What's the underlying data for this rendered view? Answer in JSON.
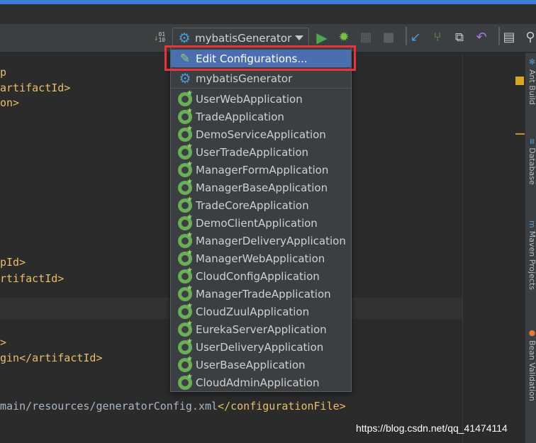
{
  "toolbar": {
    "run_config_label": "mybatisGenerator",
    "icons": [
      "sort-icon",
      "gear-icon",
      "run-icon",
      "debug-icon",
      "coverage-icon",
      "stop-icon",
      "vcs-update-icon",
      "vcs-commit-icon",
      "vcs-history-icon",
      "revert-icon",
      "project-structure-icon"
    ],
    "colors": {
      "run": "#4ea64e",
      "debug": "#7ac043",
      "accent": "#4b9bd6"
    }
  },
  "editor": {
    "lines": [
      {
        "text": "p"
      },
      {
        "text": "artifactId>"
      },
      {
        "text": "on>"
      },
      {
        "text": "pId>"
      },
      {
        "text": "rtifactId>"
      },
      {
        "text": ">"
      },
      {
        "text": "gin</artifactId>"
      }
    ],
    "config_line": {
      "path": "main/resources/generatorConfig.xml",
      "close_tag": "</configurationFile>"
    }
  },
  "dropdown": {
    "edit_label": "Edit Configurations...",
    "current": "mybatisGenerator",
    "apps": [
      "UserWebApplication",
      "TradeApplication",
      "DemoServiceApplication",
      "UserTradeApplication",
      "ManagerFormApplication",
      "ManagerBaseApplication",
      "TradeCoreApplication",
      "DemoClientApplication",
      "ManagerDeliveryApplication",
      "ManagerWebApplication",
      "CloudConfigApplication",
      "ManagerTradeApplication",
      "CloudZuulApplication",
      "EurekaServerApplication",
      "UserDeliveryApplication",
      "UserBaseApplication",
      "CloudAdminApplication"
    ],
    "selected_color": "#4b6eaf",
    "highlight_box_color": "#e8343a"
  },
  "sidebar": {
    "tabs": [
      "Ant Build",
      "Database",
      "Maven Projects",
      "Bean Validation"
    ]
  },
  "watermark": "https://blog.csdn.net/qq_41474114"
}
